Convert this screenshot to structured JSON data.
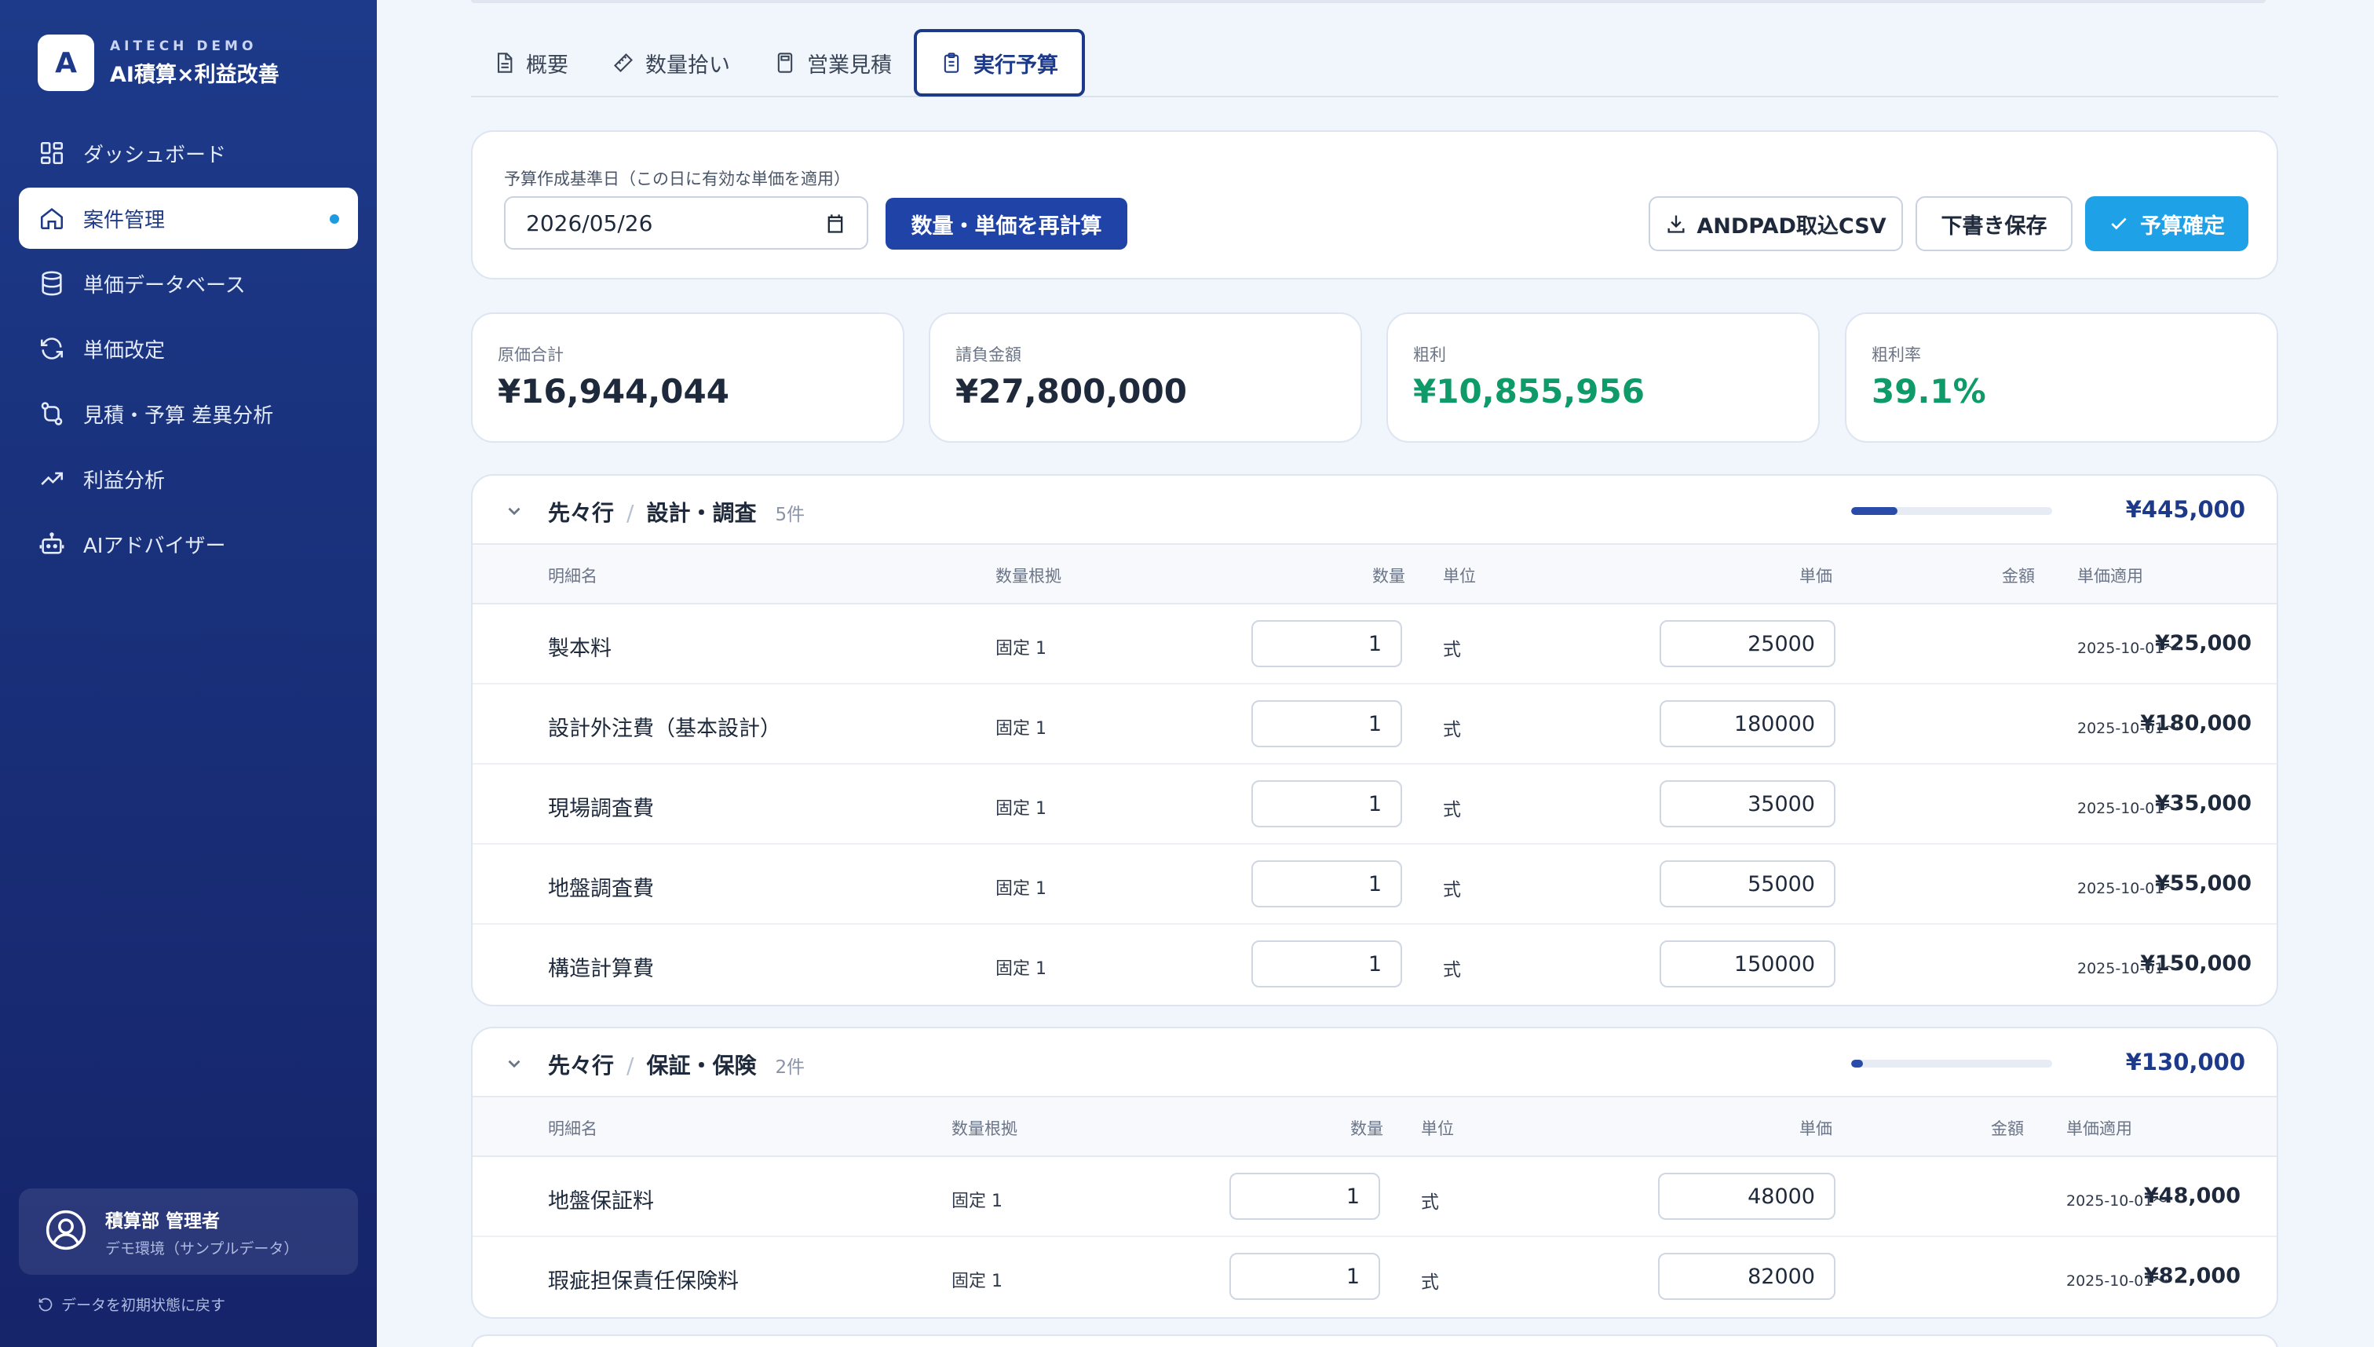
{
  "brand": {
    "logo_letter": "A",
    "subtitle": "AITECH DEMO",
    "title": "AI積算×利益改善"
  },
  "sidebar": {
    "items": [
      {
        "label": "ダッシュボード",
        "icon": "dashboard-grid-icon",
        "active": false
      },
      {
        "label": "案件管理",
        "icon": "home-icon",
        "active": true
      },
      {
        "label": "単価データベース",
        "icon": "database-icon",
        "active": false
      },
      {
        "label": "単価改定",
        "icon": "refresh-icon",
        "active": false
      },
      {
        "label": "見積・予算 差異分析",
        "icon": "compare-icon",
        "active": false
      },
      {
        "label": "利益分析",
        "icon": "trend-up-icon",
        "active": false
      },
      {
        "label": "AIアドバイザー",
        "icon": "robot-icon",
        "active": false
      }
    ],
    "user": {
      "name": "積算部 管理者",
      "role": "デモ環境（サンプルデータ）"
    },
    "reset_label": "データを初期状態に戻す"
  },
  "tabs": [
    {
      "label": "概要",
      "icon": "document-icon",
      "active": false
    },
    {
      "label": "数量拾い",
      "icon": "ruler-icon",
      "active": false
    },
    {
      "label": "営業見積",
      "icon": "calculator-icon",
      "active": false
    },
    {
      "label": "実行予算",
      "icon": "clipboard-icon",
      "active": true
    }
  ],
  "toolbar": {
    "date_label": "予算作成基準日（この日に有効な単価を適用）",
    "date_value": "2026/05/26",
    "recalc_label": "数量・単価を再計算",
    "csv_label": "ANDPAD取込CSV",
    "draft_label": "下書き保存",
    "confirm_label": "予算確定"
  },
  "kpis": [
    {
      "label": "原価合計",
      "value": "¥16,944,044",
      "tone": "default"
    },
    {
      "label": "請負金額",
      "value": "¥27,800,000",
      "tone": "default"
    },
    {
      "label": "粗利",
      "value": "¥10,855,956",
      "tone": "positive"
    },
    {
      "label": "粗利率",
      "value": "39.1%",
      "tone": "positive"
    }
  ],
  "columns": [
    "明細名",
    "数量根拠",
    "数量",
    "単位",
    "単価",
    "金額",
    "単価適用"
  ],
  "sections": [
    {
      "group": "先々行",
      "category": "設計・調査",
      "count": "5件",
      "total": "¥445,000",
      "share": 0.23,
      "rows": [
        {
          "name": "製本料",
          "basis": "固定 1",
          "qty": "1",
          "unit": "式",
          "price": "25000",
          "amount": "¥25,000",
          "applied": "2025-10-01〜"
        },
        {
          "name": "設計外注費（基本設計）",
          "basis": "固定 1",
          "qty": "1",
          "unit": "式",
          "price": "180000",
          "amount": "¥180,000",
          "applied": "2025-10-01〜"
        },
        {
          "name": "現場調査費",
          "basis": "固定 1",
          "qty": "1",
          "unit": "式",
          "price": "35000",
          "amount": "¥35,000",
          "applied": "2025-10-01〜"
        },
        {
          "name": "地盤調査費",
          "basis": "固定 1",
          "qty": "1",
          "unit": "式",
          "price": "55000",
          "amount": "¥55,000",
          "applied": "2025-10-01〜"
        },
        {
          "name": "構造計算費",
          "basis": "固定 1",
          "qty": "1",
          "unit": "式",
          "price": "150000",
          "amount": "¥150,000",
          "applied": "2025-10-01〜"
        }
      ]
    },
    {
      "group": "先々行",
      "category": "保証・保険",
      "count": "2件",
      "total": "¥130,000",
      "share": 0.06,
      "rows": [
        {
          "name": "地盤保証料",
          "basis": "固定 1",
          "qty": "1",
          "unit": "式",
          "price": "48000",
          "amount": "¥48,000",
          "applied": "2025-10-01〜"
        },
        {
          "name": "瑕疵担保責任保険料",
          "basis": "固定 1",
          "qty": "1",
          "unit": "式",
          "price": "82000",
          "amount": "¥82,000",
          "applied": "2025-10-01〜"
        }
      ]
    }
  ],
  "colors": {
    "primary": "#1d3a8a",
    "accent": "#1ea1e6",
    "positive": "#0f9a6a"
  }
}
